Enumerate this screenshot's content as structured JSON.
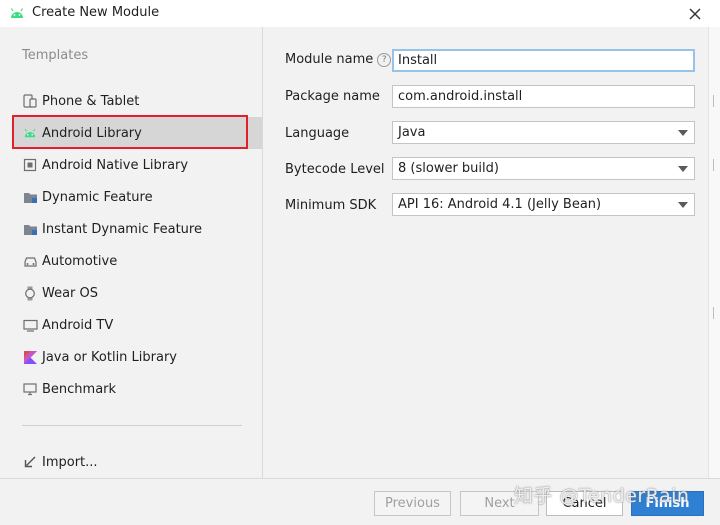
{
  "window": {
    "title": "Create New Module"
  },
  "sidebar": {
    "section_title": "Templates",
    "items": [
      {
        "label": "Phone & Tablet",
        "icon": "phone-tablet-icon"
      },
      {
        "label": "Android Library",
        "icon": "android-icon",
        "selected": true
      },
      {
        "label": "Android Native Library",
        "icon": "native-library-icon"
      },
      {
        "label": "Dynamic Feature",
        "icon": "folder-icon"
      },
      {
        "label": "Instant Dynamic Feature",
        "icon": "folder-icon"
      },
      {
        "label": "Automotive",
        "icon": "car-icon"
      },
      {
        "label": "Wear OS",
        "icon": "watch-icon"
      },
      {
        "label": "Android TV",
        "icon": "tv-icon"
      },
      {
        "label": "Java or Kotlin Library",
        "icon": "kotlin-icon"
      },
      {
        "label": "Benchmark",
        "icon": "benchmark-icon"
      }
    ],
    "import_label": "Import..."
  },
  "form": {
    "module_name": {
      "label": "Module name",
      "value": "Install"
    },
    "package_name": {
      "label": "Package name",
      "value": "com.android.install"
    },
    "language": {
      "label": "Language",
      "value": "Java"
    },
    "bytecode_level": {
      "label": "Bytecode Level",
      "value": "8 (slower build)"
    },
    "minimum_sdk": {
      "label": "Minimum SDK",
      "value": "API 16: Android 4.1 (Jelly Bean)"
    }
  },
  "footer": {
    "previous_label": "Previous",
    "next_label": "Next",
    "cancel_label": "Cancel",
    "finish_label": "Finish"
  },
  "watermark": "知乎 @TenderRain",
  "colors": {
    "accent": "#2f7fd3",
    "android_green": "#3ddc84",
    "highlight_red": "#e0202a",
    "selected_bg": "#d6d6d6"
  }
}
